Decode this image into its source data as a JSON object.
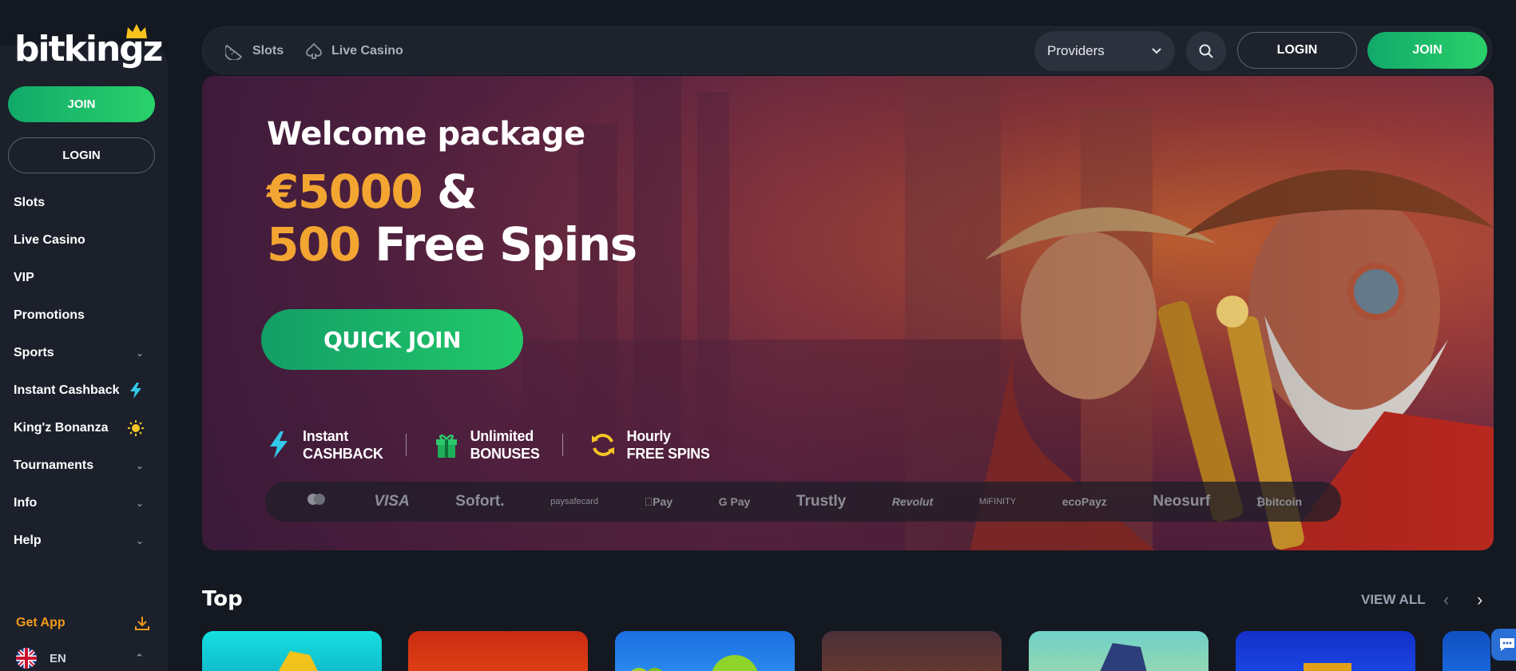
{
  "brand": {
    "name": "bitkingz"
  },
  "sidebar": {
    "join_label": "JOIN",
    "login_label": "LOGIN",
    "items": [
      {
        "label": "Slots",
        "chevron": false,
        "badge": ""
      },
      {
        "label": "Live Casino",
        "chevron": false,
        "badge": ""
      },
      {
        "label": "VIP",
        "chevron": false,
        "badge": ""
      },
      {
        "label": "Promotions",
        "chevron": false,
        "badge": ""
      },
      {
        "label": "Sports",
        "chevron": true,
        "badge": ""
      },
      {
        "label": "Instant Cashback",
        "chevron": false,
        "badge": "lightning-icon"
      },
      {
        "label": "King'z Bonanza",
        "chevron": false,
        "badge": "sun-icon"
      },
      {
        "label": "Tournaments",
        "chevron": true,
        "badge": ""
      },
      {
        "label": "Info",
        "chevron": true,
        "badge": ""
      },
      {
        "label": "Help",
        "chevron": true,
        "badge": ""
      }
    ],
    "get_app_label": "Get App",
    "language": "EN"
  },
  "topbar": {
    "slots_label": "Slots",
    "live_casino_label": "Live Casino",
    "providers_label": "Providers",
    "login_label": "LOGIN",
    "join_label": "JOIN"
  },
  "hero": {
    "title": "Welcome package",
    "amount": "€5000",
    "amp": " &",
    "spins_count": "500",
    "spins_label": " Free Spins",
    "cta_label": "QUICK JOIN",
    "features": [
      {
        "line1": "Instant",
        "line2": "CASHBACK",
        "icon": "lightning-icon"
      },
      {
        "line1": "Unlimited",
        "line2": "BONUSES",
        "icon": "gift-icon"
      },
      {
        "line1": "Hourly",
        "line2": "FREE SPINS",
        "icon": "refresh-icon"
      }
    ],
    "payments": [
      "",
      "VISA",
      "Sofort.",
      "paysafecard",
      "Pay",
      "G Pay",
      "Trustly",
      "Revolut",
      "MiFINITY",
      "ecoPayz",
      "Neosurf",
      "bitcoin"
    ]
  },
  "top_section": {
    "title": "Top",
    "view_all_label": "VIEW ALL"
  },
  "colors": {
    "accent_green": "#1fbf6a",
    "accent_orange": "#f3a531",
    "background": "#141821"
  }
}
